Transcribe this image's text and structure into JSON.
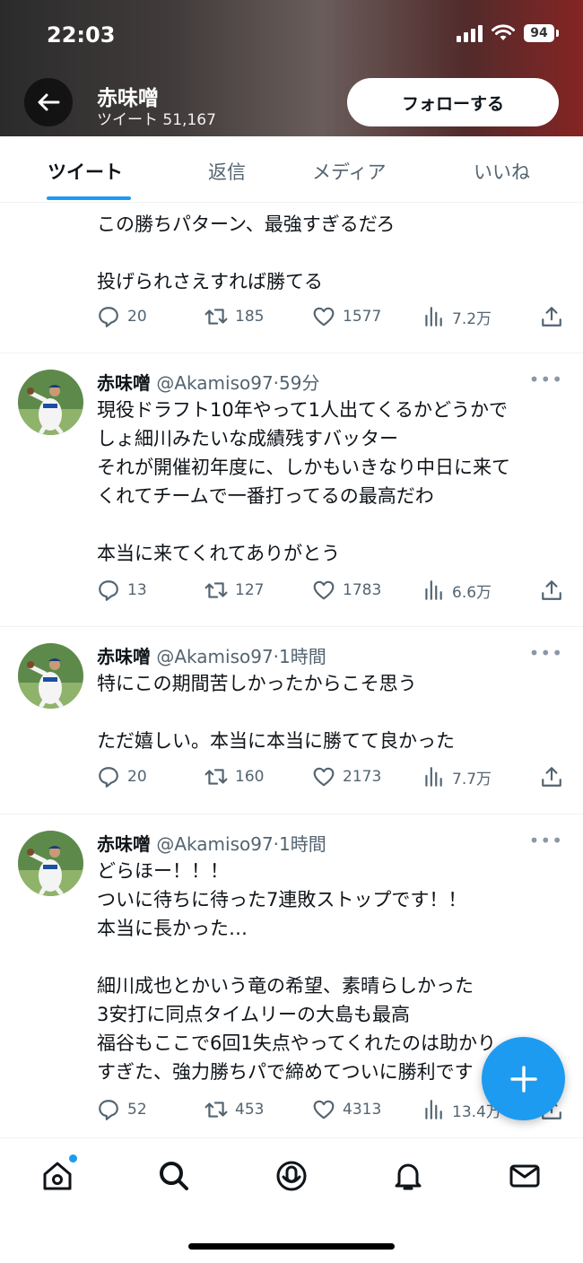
{
  "status_bar": {
    "time": "22:03",
    "battery": "94"
  },
  "header": {
    "name": "赤味噌",
    "tweet_count": "ツイート 51,167",
    "follow_label": "フォローする"
  },
  "tabs": [
    "ツイート",
    "返信",
    "メディア",
    "いいね"
  ],
  "tweets": [
    {
      "lines": [
        "この勝ちパターン、最強すぎるだろ",
        "",
        "投げられさえすれば勝てる"
      ],
      "replies": "20",
      "retweets": "185",
      "likes": "1577",
      "views": "7.2万"
    },
    {
      "name": "赤味噌",
      "handle": "@Akamiso97",
      "time": "59分",
      "lines": [
        "現役ドラフト10年やって1人出てくるかどうかで",
        "しょ細川みたいな成績残すバッター",
        "それが開催初年度に、しかもいきなり中日に来て",
        "くれてチームで一番打ってるの最高だわ",
        "",
        "本当に来てくれてありがとう"
      ],
      "replies": "13",
      "retweets": "127",
      "likes": "1783",
      "views": "6.6万"
    },
    {
      "name": "赤味噌",
      "handle": "@Akamiso97",
      "time": "1時間",
      "lines": [
        "特にこの期間苦しかったからこそ思う",
        "",
        "ただ嬉しい。本当に本当に勝てて良かった"
      ],
      "replies": "20",
      "retweets": "160",
      "likes": "2173",
      "views": "7.7万"
    },
    {
      "name": "赤味噌",
      "handle": "@Akamiso97",
      "time": "1時間",
      "lines": [
        "どらほー！！！",
        "ついに待ちに待った7連敗ストップです！！",
        "本当に長かった…",
        "",
        "細川成也とかいう竜の希望、素晴らしかった",
        "3安打に同点タイムリーの大島も最高",
        "福谷もここで6回1失点やってくれたのは助かり",
        "すぎた、強力勝ちパで締めてついに勝利です"
      ],
      "replies": "52",
      "retweets": "453",
      "likes": "4313",
      "views": "13.4万"
    }
  ],
  "colors": {
    "accent": "#1d9bf0",
    "text": "#0f1419",
    "secondary": "#536471"
  },
  "icons": [
    "back-arrow-icon",
    "reply-icon",
    "retweet-icon",
    "like-icon",
    "views-icon",
    "share-icon",
    "more-icon",
    "compose-plus-icon",
    "home-icon",
    "search-icon",
    "spaces-icon",
    "bell-icon",
    "mail-icon"
  ]
}
